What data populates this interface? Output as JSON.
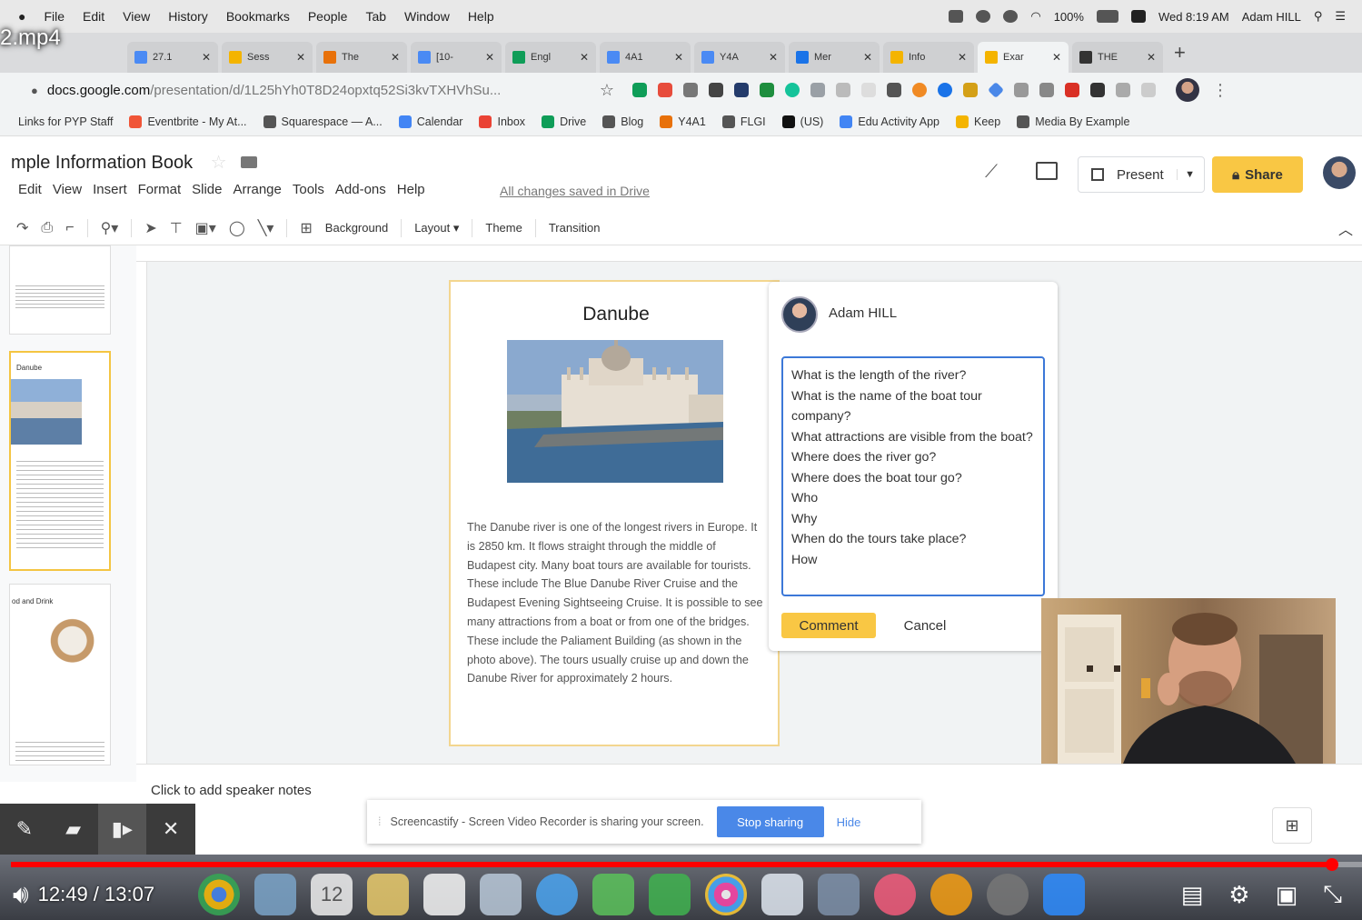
{
  "menubar": {
    "items": [
      "File",
      "Edit",
      "View",
      "History",
      "Bookmarks",
      "People",
      "Tab",
      "Window",
      "Help"
    ],
    "battery": "100%",
    "clock": "Wed 8:19 AM",
    "user": "Adam HILL"
  },
  "video": {
    "title": "2.mp4",
    "time": "12:49 / 13:07",
    "progress_fraction": 0.978
  },
  "tabs": [
    {
      "label": "27.1",
      "color": "#4a8af4",
      "active": false
    },
    {
      "label": "Sess",
      "color": "#f4b400",
      "active": false
    },
    {
      "label": "The",
      "color": "#e8710a",
      "active": false
    },
    {
      "label": "[10-",
      "color": "#4a8af4",
      "active": false
    },
    {
      "label": "Engl",
      "color": "#0f9d58",
      "active": false
    },
    {
      "label": "4A1",
      "color": "#4a8af4",
      "active": false
    },
    {
      "label": "Y4A",
      "color": "#4a8af4",
      "active": false
    },
    {
      "label": "Mer",
      "color": "#1a73e8",
      "active": false
    },
    {
      "label": "Info",
      "color": "#f4b400",
      "active": false
    },
    {
      "label": "Exar",
      "color": "#f4b400",
      "active": true
    },
    {
      "label": "THE",
      "color": "#333333",
      "active": false
    }
  ],
  "address": {
    "domain": "docs.google.com",
    "path": "/presentation/d/1L25hYh0T8D24opxtq52Si3kvTXHVhSu..."
  },
  "bookmarks": [
    {
      "label": "Links for PYP Staff",
      "color": "#9aa0a6"
    },
    {
      "label": "Eventbrite - My At...",
      "color": "#f05537"
    },
    {
      "label": "Squarespace — A...",
      "color": "#555555"
    },
    {
      "label": "Calendar",
      "color": "#4285f4"
    },
    {
      "label": "Inbox",
      "color": "#ea4335"
    },
    {
      "label": "Drive",
      "color": "#0f9d58"
    },
    {
      "label": "Blog",
      "color": "#555555"
    },
    {
      "label": "Y4A1",
      "color": "#e8710a"
    },
    {
      "label": "FLGI",
      "color": "#555555"
    },
    {
      "label": "(US)",
      "color": "#111111"
    },
    {
      "label": "Edu Activity App",
      "color": "#4285f4"
    },
    {
      "label": "Keep",
      "color": "#f4b400"
    },
    {
      "label": "Media By Example",
      "color": "#555555"
    }
  ],
  "doc": {
    "title": "mple Information Book",
    "menus": [
      "Edit",
      "View",
      "Insert",
      "Format",
      "Slide",
      "Arrange",
      "Tools",
      "Add-ons",
      "Help"
    ],
    "saved": "All changes saved in Drive",
    "present": "Present",
    "share": "Share"
  },
  "toolbar": {
    "background": "Background",
    "layout": "Layout",
    "theme": "Theme",
    "transition": "Transition"
  },
  "slide": {
    "title": "Danube",
    "body": "The Danube river is one of the longest rivers in Europe. It is 2850 km. It flows straight through the middle of Budapest city. Many boat tours are available for tourists. These include The Blue Danube River Cruise and the Budapest Evening Sightseeing Cruise. It is possible to see many attractions from a boat or from one of the bridges. These include the Paliament Building (as shown in the photo above). The tours usually cruise up and down the Danube River for approximately 2 hours."
  },
  "filmstrip": {
    "thumb2_title": "Danube",
    "thumb3_title": "od and Drink"
  },
  "comment": {
    "user": "Adam HILL",
    "lines": [
      "What is the length of the river?",
      "What is the name of the boat tour company?",
      "What attractions are visible from the boat?",
      "Where does the river go?",
      "Where does the boat tour go?",
      "Who",
      "Why",
      "When do the tours take place?",
      "How"
    ],
    "comment_btn": "Comment",
    "cancel_btn": "Cancel"
  },
  "notes": {
    "placeholder": "Click to add speaker notes"
  },
  "screencastify": {
    "message": "Screencastify - Screen Video Recorder is sharing your screen.",
    "stop": "Stop sharing",
    "hide": "Hide"
  },
  "dock": {
    "calendar_day": "12"
  }
}
